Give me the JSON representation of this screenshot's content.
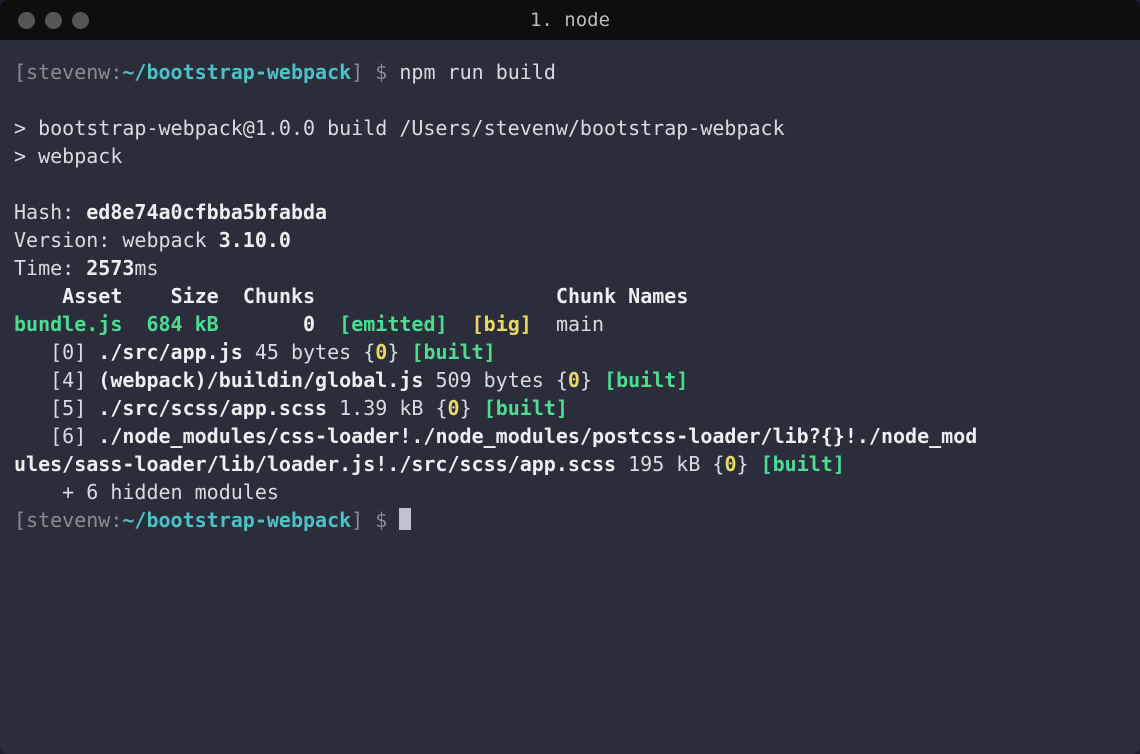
{
  "window": {
    "title": "1. node"
  },
  "prompt": {
    "user": "stevenw",
    "separator": ":",
    "path": "~/bootstrap-webpack",
    "symbol": "$",
    "command": "npm run build"
  },
  "output": {
    "script_line1": "> bootstrap-webpack@1.0.0 build /Users/stevenw/bootstrap-webpack",
    "script_line2": "> webpack",
    "hash_label": "Hash: ",
    "hash_value": "ed8e74a0cfbba5bfabda",
    "version_label": "Version: ",
    "version_app": "webpack ",
    "version_value": "3.10.0",
    "time_label": "Time: ",
    "time_value": "2573",
    "time_unit": "ms",
    "header_asset": "Asset",
    "header_size": "Size",
    "header_chunks": "Chunks",
    "header_chunknames": "Chunk Names",
    "bundle": {
      "name": "bundle.js",
      "size": "684 kB",
      "chunks": "0",
      "emitted": "[emitted]",
      "big": "[big]",
      "chunkname": "main"
    },
    "modules": [
      {
        "index": "[0]",
        "path": "./src/app.js",
        "size": "45 bytes",
        "chunk": "0",
        "status": "[built]"
      },
      {
        "index": "[4]",
        "path": "(webpack)/buildin/global.js",
        "size": "509 bytes",
        "chunk": "0",
        "status": "[built]"
      },
      {
        "index": "[5]",
        "path": "./src/scss/app.scss",
        "size": "1.39 kB",
        "chunk": "0",
        "status": "[built]"
      },
      {
        "index": "[6]",
        "path_line1": "./node_modules/css-loader!./node_modules/postcss-loader/lib?{}!./node_mod",
        "path_line2": "ules/sass-loader/lib/loader.js!./src/scss/app.scss",
        "size": "195 kB",
        "chunk": "0",
        "status": "[built]"
      }
    ],
    "hidden": "    + 6 hidden modules"
  },
  "prompt2": {
    "user": "stevenw",
    "separator": ":",
    "path": "~/bootstrap-webpack",
    "symbol": "$"
  }
}
